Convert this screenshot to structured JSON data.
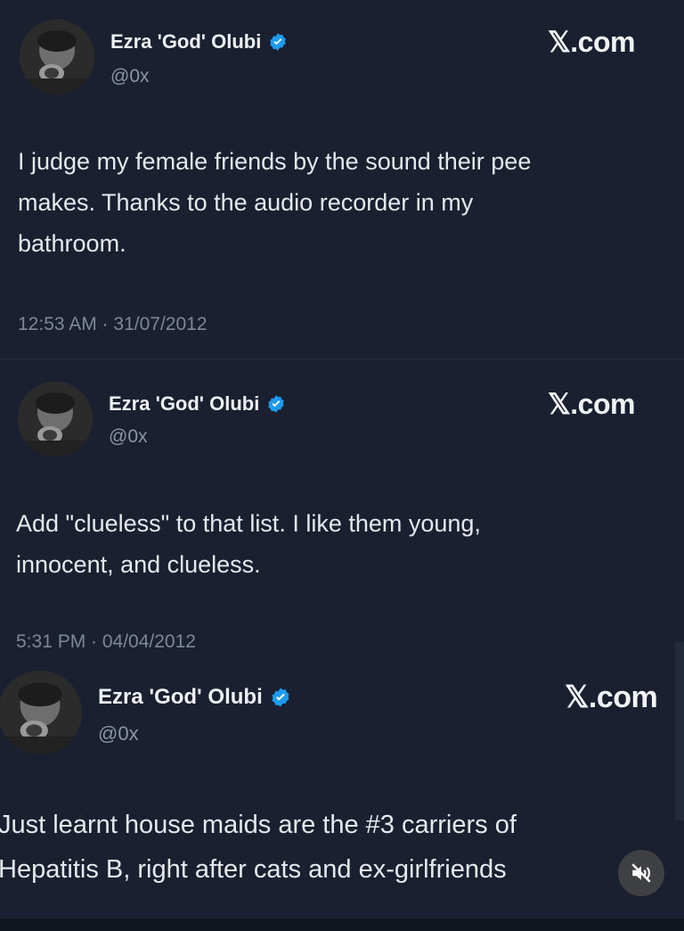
{
  "brand_label": "𝕏.com",
  "tweets": [
    {
      "author_name": "Ezra 'God' Olubi",
      "handle": "@0x",
      "text_lines": [
        "I judge my female friends by the sound their pee",
        "makes. Thanks to the audio recorder in my",
        "bathroom."
      ],
      "timestamp": "12:53 AM · 31/07/2012"
    },
    {
      "author_name": "Ezra 'God' Olubi",
      "handle": "@0x",
      "text_lines": [
        "Add \"clueless\" to that list. I like them young,",
        "innocent, and clueless."
      ],
      "timestamp": "5:31 PM · 04/04/2012"
    },
    {
      "author_name": "Ezra 'God' Olubi",
      "handle": "@0x",
      "text_lines": [
        "Just learnt house maids are the #3 carriers of",
        "Hepatitis B, right after cats and ex-girlfriends"
      ],
      "timestamp": ""
    }
  ],
  "icons": {
    "verified": "verified-badge-icon",
    "mute": "speaker-muted-icon"
  },
  "colors": {
    "background": "#1a2030",
    "verified_blue": "#1d9bf0",
    "handle_gray": "#8b96a3",
    "timestamp_gray": "#7d8896"
  }
}
